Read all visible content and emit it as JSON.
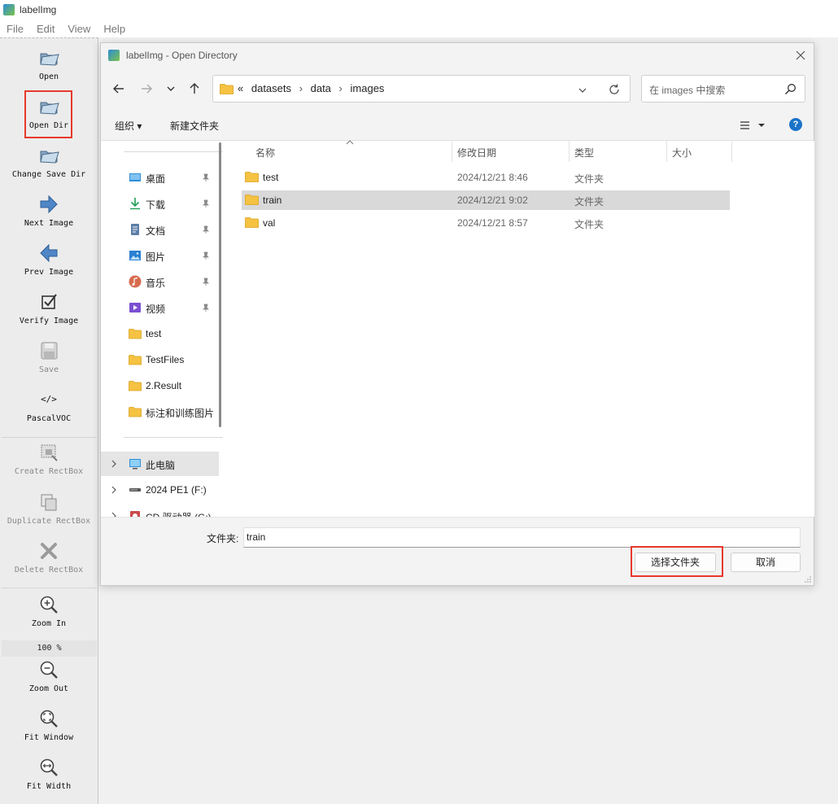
{
  "app": {
    "title": "labelImg"
  },
  "menu": [
    "File",
    "Edit",
    "View",
    "Help"
  ],
  "toolbar": {
    "items": [
      {
        "label": "Open",
        "icon": "folder-icon"
      },
      {
        "label": "Open Dir",
        "icon": "folder-icon"
      },
      {
        "label": "Change Save Dir",
        "icon": "folder-icon"
      },
      {
        "label": "Next Image",
        "icon": "arrow-right-icon"
      },
      {
        "label": "Prev Image",
        "icon": "arrow-left-icon"
      },
      {
        "label": "Verify Image",
        "icon": "checkbox-icon"
      },
      {
        "label": "Save",
        "icon": "save-icon"
      },
      {
        "label": "PascalVOC",
        "icon": "code-icon"
      },
      {
        "label": "Create RectBox",
        "icon": "create-rect-icon"
      },
      {
        "label": "Duplicate RectBox",
        "icon": "duplicate-icon"
      },
      {
        "label": "Delete RectBox",
        "icon": "delete-icon"
      },
      {
        "label": "Zoom In",
        "icon": "zoom-in-icon"
      },
      {
        "label": "Zoom Out",
        "icon": "zoom-out-icon"
      },
      {
        "label": "Fit Window",
        "icon": "fit-window-icon"
      },
      {
        "label": "Fit Width",
        "icon": "fit-width-icon"
      }
    ],
    "zoom_value": "100 %",
    "pascal_symbol": "</>"
  },
  "dialog": {
    "title": "labelImg - Open Directory",
    "address": {
      "prefix": "«",
      "segments": [
        "datasets",
        "data",
        "images"
      ],
      "separator": "›"
    },
    "search_placeholder": "在 images 中搜索",
    "commands": {
      "organize": "组织 ▾",
      "new_folder": "新建文件夹",
      "help": "?"
    },
    "nav_items": [
      {
        "label": "桌面",
        "icon": "desktop-icon",
        "pinned": true
      },
      {
        "label": "下载",
        "icon": "download-icon",
        "pinned": true
      },
      {
        "label": "文档",
        "icon": "document-icon",
        "pinned": true
      },
      {
        "label": "图片",
        "icon": "pictures-icon",
        "pinned": true
      },
      {
        "label": "音乐",
        "icon": "music-icon",
        "pinned": true
      },
      {
        "label": "视频",
        "icon": "video-icon",
        "pinned": true
      },
      {
        "label": "test",
        "icon": "folder-icon",
        "pinned": false
      },
      {
        "label": "TestFiles",
        "icon": "folder-icon",
        "pinned": false
      },
      {
        "label": "2.Result",
        "icon": "folder-icon",
        "pinned": false
      },
      {
        "label": "标注和训练图片",
        "icon": "folder-icon",
        "pinned": false
      }
    ],
    "drive_items": [
      {
        "label": "此电脑",
        "icon": "computer-icon",
        "selected": true
      },
      {
        "label": "2024 PE1 (F:)",
        "icon": "drive-icon",
        "selected": false
      },
      {
        "label": "CD 驱动器 (G:)",
        "icon": "cd-drive-icon",
        "selected": false
      }
    ],
    "columns": [
      "名称",
      "修改日期",
      "类型",
      "大小"
    ],
    "files": [
      {
        "name": "test",
        "date": "2024/12/21 8:46",
        "type": "文件夹",
        "selected": false
      },
      {
        "name": "train",
        "date": "2024/12/21 9:02",
        "type": "文件夹",
        "selected": true
      },
      {
        "name": "val",
        "date": "2024/12/21 8:57",
        "type": "文件夹",
        "selected": false
      }
    ],
    "folder_label": "文件夹:",
    "folder_value": "train",
    "select_button": "选择文件夹",
    "cancel_button": "取消"
  },
  "colors": {
    "highlight_red": "#e8392b",
    "folder_yellow": "#f5c242",
    "selection_gray": "#d9d9d9",
    "help_blue": "#1a73c8"
  }
}
